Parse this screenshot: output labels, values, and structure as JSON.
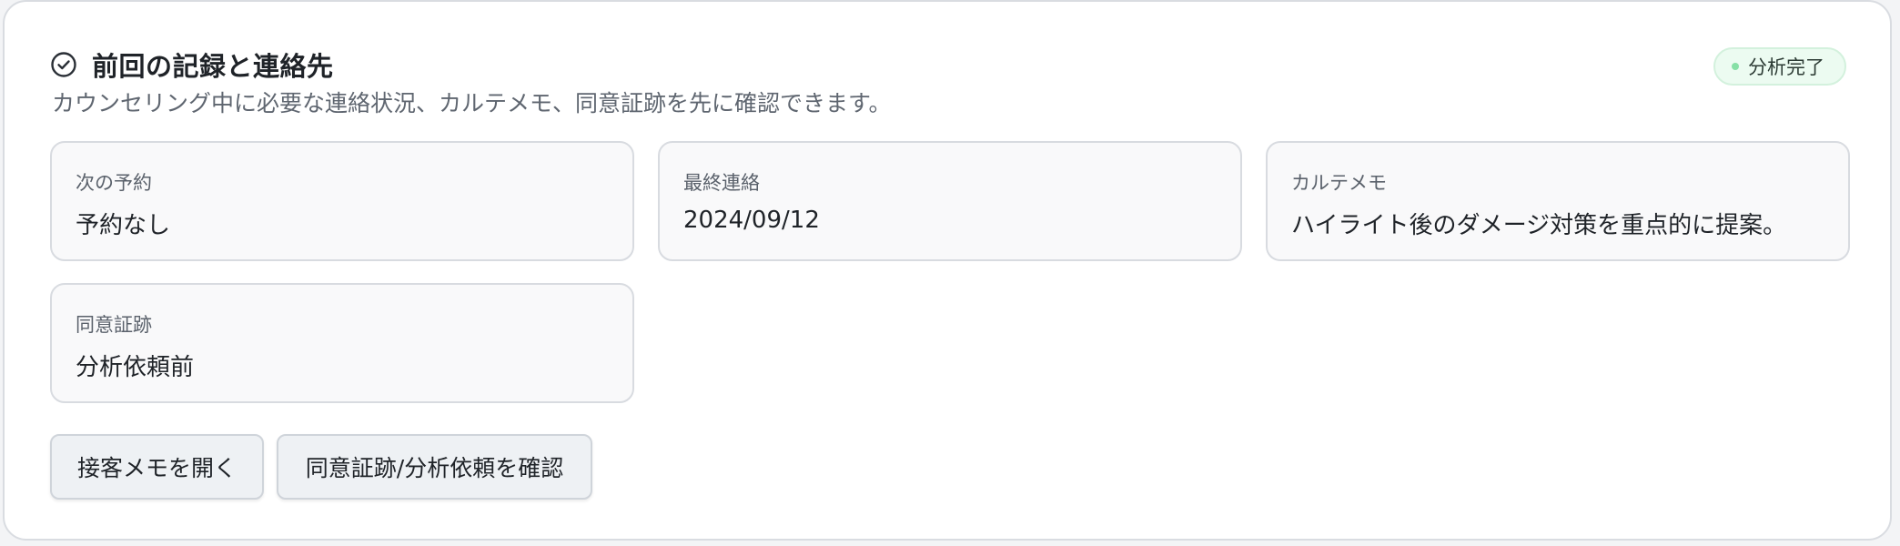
{
  "header": {
    "title": "前回の記録と連絡先",
    "subtitle": "カウンセリング中に必要な連絡状況、カルテメモ、同意証跡を先に確認できます。",
    "icon": "check-circle-icon"
  },
  "status_badge": {
    "label": "分析完了",
    "dot_color": "#86e0a6"
  },
  "info_cards": [
    {
      "label": "次の予約",
      "value": "予約なし"
    },
    {
      "label": "最終連絡",
      "value": "2024/09/12"
    },
    {
      "label": "カルテメモ",
      "value": "ハイライト後のダメージ対策を重点的に提案。"
    },
    {
      "label": "同意証跡",
      "value": "分析依頼前"
    }
  ],
  "actions": {
    "open_memo": "接客メモを開く",
    "check_consent": "同意証跡/分析依頼を確認"
  }
}
